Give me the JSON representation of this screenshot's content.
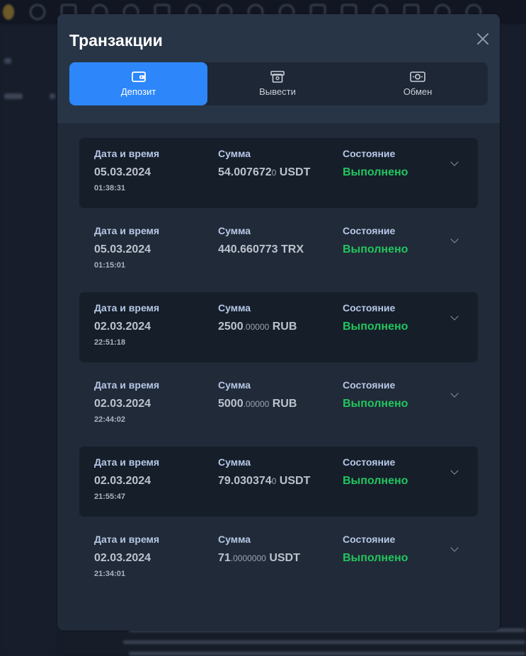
{
  "modal": {
    "title": "Транзакции"
  },
  "tabs": [
    {
      "label": "Депозит",
      "icon": "wallet-icon",
      "active": true
    },
    {
      "label": "Вывести",
      "icon": "withdraw-icon",
      "active": false
    },
    {
      "label": "Обмен",
      "icon": "exchange-icon",
      "active": false
    }
  ],
  "labels": {
    "datetime": "Дата и время",
    "amount": "Сумма",
    "status": "Состояние"
  },
  "transactions": [
    {
      "date": "05.03.2024",
      "time": "01:38:31",
      "amount_main": "54.007672",
      "amount_dec": "0",
      "currency": "USDT",
      "status": "Выполнено"
    },
    {
      "date": "05.03.2024",
      "time": "01:15:01",
      "amount_main": "440.660773",
      "amount_dec": "",
      "currency": "TRX",
      "status": "Выполнено"
    },
    {
      "date": "02.03.2024",
      "time": "22:51:18",
      "amount_main": "2500",
      "amount_dec": ".00000",
      "currency": "RUB",
      "status": "Выполнено"
    },
    {
      "date": "02.03.2024",
      "time": "22:44:02",
      "amount_main": "5000",
      "amount_dec": ".00000",
      "currency": "RUB",
      "status": "Выполнено"
    },
    {
      "date": "02.03.2024",
      "time": "21:55:47",
      "amount_main": "79.030374",
      "amount_dec": "0",
      "currency": "USDT",
      "status": "Выполнено"
    },
    {
      "date": "02.03.2024",
      "time": "21:34:01",
      "amount_main": "71",
      "amount_dec": ".0000000",
      "currency": "USDT",
      "status": "Выполнено"
    }
  ],
  "colors": {
    "accent": "#2d87fa",
    "status_success": "#22c55e",
    "modal_bg": "#212a38"
  }
}
